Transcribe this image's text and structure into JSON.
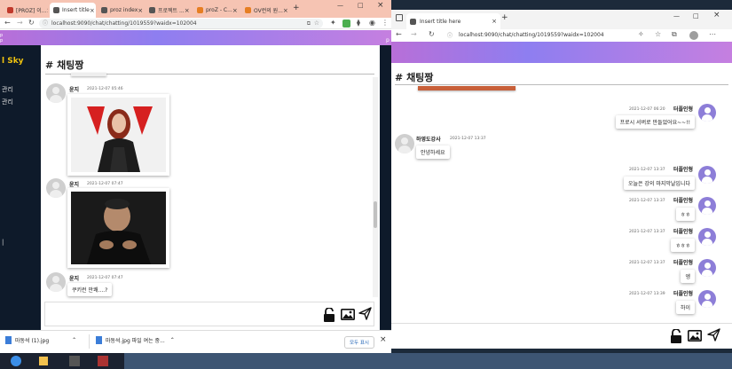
{
  "left_window": {
    "tabs": [
      {
        "label": "[PROZ] 이...",
        "color": "#c0392b"
      },
      {
        "label": "Insert title",
        "color": "#555555"
      },
      {
        "label": "proz index",
        "color": "#555555"
      },
      {
        "label": "프로젝트 ...",
        "color": "#555555"
      },
      {
        "label": "proZ - C...",
        "color": "#e67e22"
      },
      {
        "label": "OV런의 원...",
        "color": "#e67e22"
      }
    ],
    "new_tab": "+",
    "url": "localhost:9090/chat/chatting/1019559?waidx=102004",
    "sidebar_brand": "l Sky",
    "sidebar_items": [
      "관리",
      "관리"
    ],
    "chat_title": "채팅짱",
    "hash": "#",
    "messages": [
      {
        "name": "윤지",
        "time": "2021-12-07 05:46"
      },
      {
        "name": "윤지",
        "time": "2021-12-07 07:47"
      },
      {
        "name": "윤지",
        "time": "2021-12-07 07:47",
        "text": "쿠키런 만쾌....?"
      }
    ],
    "downloads": [
      {
        "name": "마동석 (1).jpg"
      },
      {
        "name": "마동석.jpg 파일 여는 중..."
      }
    ],
    "show_all_label": "모두 표시",
    "close": "×"
  },
  "right_window": {
    "tab_label": "Insert title here",
    "new_tab": "+",
    "url": "localhost:9090/chat/chatting/1019559?waidx=102004",
    "chat_title": "채팅짱",
    "hash": "#",
    "messages": [
      {
        "side": "right",
        "name": "터플인형",
        "time": "2021-12-07 06:20",
        "text": "프로시 서버로 만들었어요~~!!"
      },
      {
        "side": "left",
        "name": "하영도강사",
        "time": "2021-12-07 13:37",
        "text": "안녕하세요"
      },
      {
        "side": "right",
        "name": "터플인형",
        "time": "2021-12-07 13:37",
        "text": "오늘은 강의 마지막날입니다"
      },
      {
        "side": "right",
        "name": "터플인형",
        "time": "2021-12-07 13:37",
        "text": "ㅎㅎ"
      },
      {
        "side": "right",
        "name": "터플인형",
        "time": "2021-12-07 13:37",
        "text": "ㅎㅎㅎ"
      },
      {
        "side": "right",
        "name": "터플인형",
        "time": "2021-12-07 13:37",
        "text": "엥"
      },
      {
        "side": "right",
        "name": "터플인형",
        "time": "2021-12-07 13:39",
        "text": "하이"
      }
    ]
  },
  "colors": {
    "banner_from": "#b86fd8",
    "banner_to": "#8e7ef0",
    "avatar_purple": "#8d7ed8",
    "tab_strip": "#f6c4b3"
  },
  "icons": [
    "lock-icon",
    "image-icon",
    "send-icon",
    "back-icon",
    "forward-icon",
    "reload-icon",
    "star-icon",
    "extension-icon",
    "menu-icon"
  ]
}
